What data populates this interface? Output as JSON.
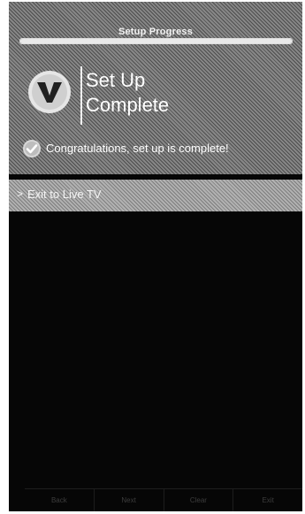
{
  "setup_progress": {
    "label": "Setup Progress",
    "value_percent": 100
  },
  "header": {
    "logo_icon": "vizio-v-logo-icon",
    "title_line1": "Set Up",
    "title_line2": "Complete"
  },
  "status": {
    "icon": "checkmark-icon",
    "message": "Congratulations, set up is complete!"
  },
  "menu": {
    "items": [
      {
        "arrow": ">",
        "label": "Exit to Live TV"
      }
    ]
  },
  "nav": {
    "items": [
      {
        "label": "Back"
      },
      {
        "label": "Next"
      },
      {
        "label": "Clear"
      },
      {
        "label": "Exit"
      }
    ]
  },
  "colors": {
    "screen_background": "#060606",
    "text": "#ffffff",
    "highlight": "#a8a8a8"
  }
}
